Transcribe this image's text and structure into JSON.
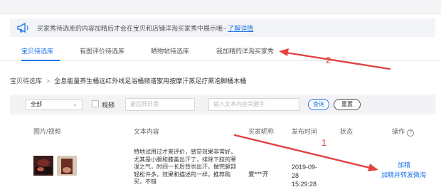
{
  "notice": {
    "text": "买家秀待选库的内容加精后才会在宝贝和店铺洋淘买家秀中展示哦~",
    "link": "了解详情"
  },
  "tabs": [
    {
      "label": "宝贝待选库",
      "active": true
    },
    {
      "label": "有图评价待选库",
      "active": false
    },
    {
      "label": "晒物帖待选库",
      "active": false
    },
    {
      "label": "我加精的洋淘买家秀",
      "active": false
    }
  ],
  "breadcrumb": {
    "root": "宝贝待选库",
    "separator": ">",
    "current": "全息能量养生桶远红外线足浴桶频谱家用按摩汗蒸足疗熏泡脚桶木桶"
  },
  "filter": {
    "select_value": "全部",
    "checkbox_label": "视频",
    "date_placeholder": "最后筛日期",
    "keyword_placeholder": "输入文本内容关键字",
    "query_label": "查询",
    "reset_label": "重置"
  },
  "table": {
    "headers": {
      "media": "图片/视频",
      "content": "文本内容",
      "nickname": "买家昵称",
      "time": "发布时间",
      "status": "状态",
      "action": "操作"
    },
    "help_glyph": "?",
    "rows": [
      {
        "content": "特地试用过才来评价，感觉效果非常好，尤其是小腿和膝盖出汗了，排除下肢的寒湿之气，时间一长后背也出汗，做完腿部轻松许多，效果和描述的一样，推荐购买，不错",
        "nickname": "爱***齐",
        "time": "2019-09-28 15:29:28",
        "status": "",
        "actions": [
          "加精",
          "加精并转发微淘"
        ]
      }
    ]
  },
  "annotations": {
    "label_1": "1",
    "label_2": "2",
    "color": "#e04343"
  },
  "colors": {
    "accent": "#1a73e8",
    "notice_bg": "#f2f4f8",
    "filter_bg": "#f3f3f5"
  }
}
